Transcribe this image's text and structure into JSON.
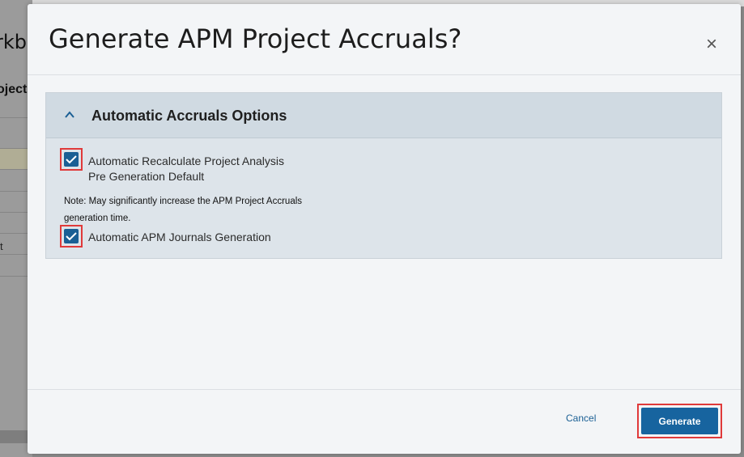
{
  "background": {
    "title_fragment": "rkb",
    "subtitle_fragment": "oject",
    "row_text_fragment": "t"
  },
  "dialog": {
    "title": "Generate APM Project Accruals?",
    "close_symbol": "×",
    "close_icon": "close-icon",
    "section": {
      "title": "Automatic Accruals Options",
      "toggle_icon": "chevron-up-icon",
      "options": [
        {
          "label_line1": "Automatic Recalculate Project Analysis",
          "label_line2": "Pre Generation Default",
          "checked": true
        },
        {
          "label_line1": "Automatic APM Journals Generation",
          "checked": true
        }
      ],
      "note": "Note: May significantly increase the APM Project Accruals generation time."
    },
    "footer": {
      "cancel_label": "Cancel",
      "generate_label": "Generate"
    },
    "colors": {
      "accent": "#17649f",
      "highlight": "#e03a3a"
    }
  }
}
